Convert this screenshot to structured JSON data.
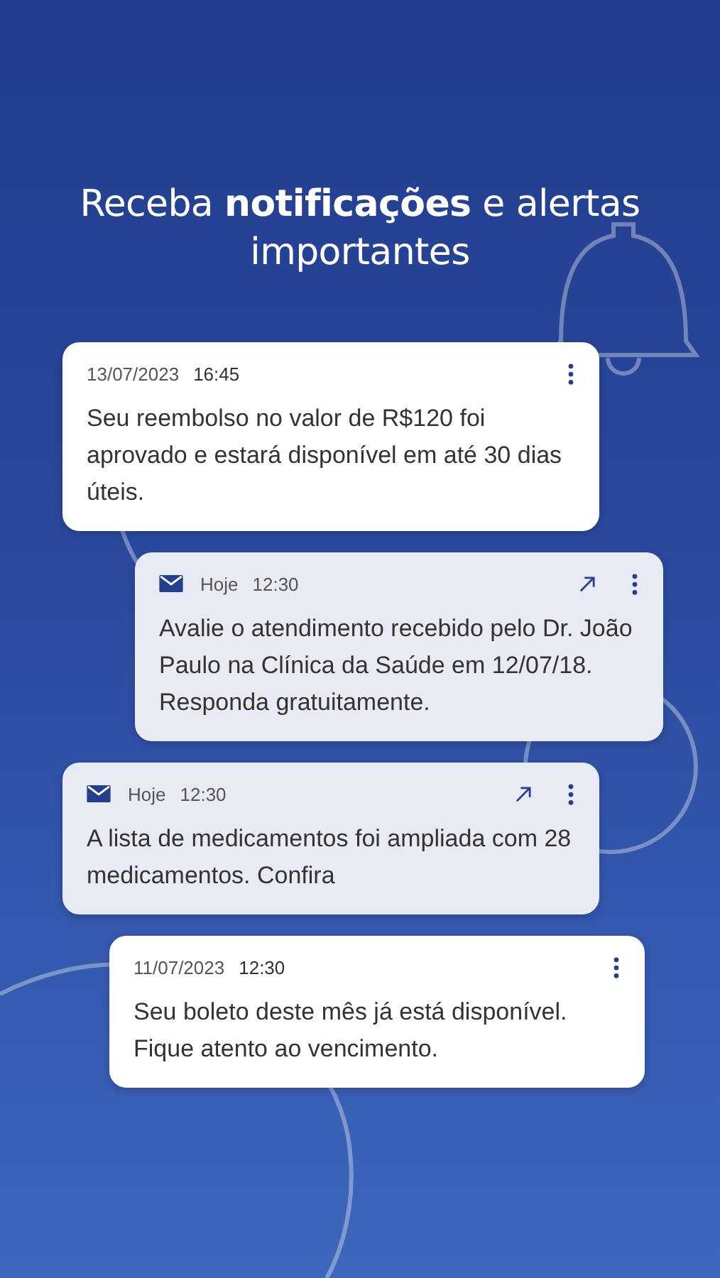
{
  "heading": "Receba **notificações** e alertas importantes",
  "notifications": [
    {
      "unread": false,
      "date": "13/07/2023",
      "time": "16:45",
      "message": "Seu reembolso no valor de R$120 foi aprovado e estará disponível em até 30 dias úteis."
    },
    {
      "unread": true,
      "date": "Hoje",
      "time": "12:30",
      "message": "Avalie o atendimento recebido pelo Dr. João Paulo na Clínica da Saúde em 12/07/18. Responda gratuitamente."
    },
    {
      "unread": true,
      "date": "Hoje",
      "time": "12:30",
      "message": "A lista de medicamentos foi ampliada com 28 medicamentos. Confira"
    },
    {
      "unread": false,
      "date": "11/07/2023",
      "time": "12:30",
      "message": "Seu boleto deste mês já está disponível. Fique atento ao vencimento."
    }
  ]
}
